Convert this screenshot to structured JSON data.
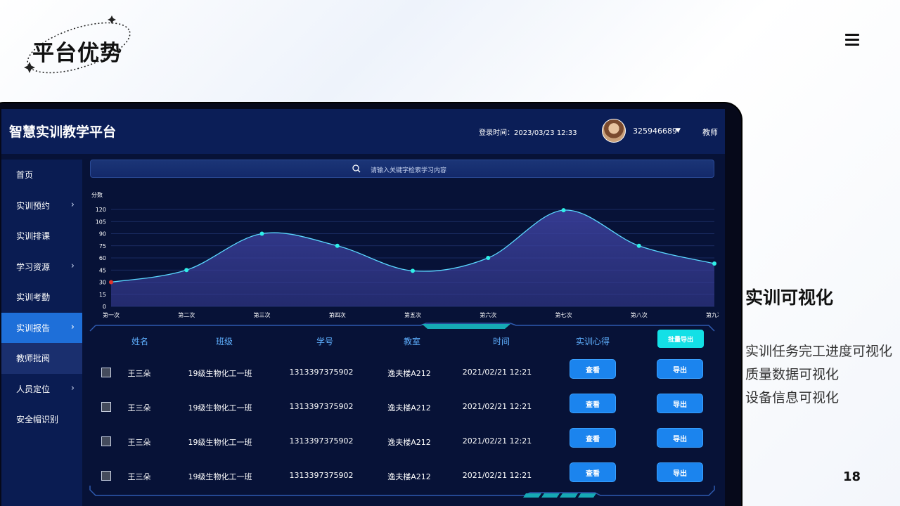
{
  "slide": {
    "title": "平台优势",
    "page_number": "18",
    "feature_title": "实训可视化",
    "features": [
      "实训任务完工进度可视化",
      "质量数据可视化",
      "设备信息可视化"
    ]
  },
  "app": {
    "title": "智慧实训教学平台",
    "login_time": "登录时间：2023/03/23 12:33",
    "user_id": "325946689",
    "role": "教师",
    "search_placeholder": "请输入关键字检索学习内容"
  },
  "sidebar": {
    "items": [
      {
        "label": "首页",
        "chevron": false
      },
      {
        "label": "实训预约",
        "chevron": true
      },
      {
        "label": "实训排课",
        "chevron": false
      },
      {
        "label": "学习资源",
        "chevron": true
      },
      {
        "label": "实训考勤",
        "chevron": false
      },
      {
        "label": "实训报告",
        "chevron": true,
        "active": true
      },
      {
        "label": "教师批阅",
        "chevron": false
      },
      {
        "label": "人员定位",
        "chevron": true
      },
      {
        "label": "安全帽识别",
        "chevron": false
      }
    ]
  },
  "chart_data": {
    "type": "area",
    "ylabel": "分数",
    "ylim": [
      0,
      120
    ],
    "yticks": [
      0,
      15,
      30,
      45,
      60,
      75,
      90,
      105,
      120
    ],
    "categories": [
      "第一次",
      "第二次",
      "第三次",
      "第四次",
      "第五次",
      "第六次",
      "第七次",
      "第八次",
      "第九次"
    ],
    "values": [
      30,
      45,
      90,
      75,
      44,
      60,
      119,
      75,
      53
    ],
    "grid": true,
    "colors": {
      "line": "#5ad8ff",
      "point": "#2ff0e8",
      "first_point": "#e0342c",
      "fill": "#3a3f9a"
    }
  },
  "table": {
    "headers": [
      "姓名",
      "班级",
      "学号",
      "教室",
      "时间",
      "实训心得"
    ],
    "export_all_label": "批量导出",
    "view_label": "查看",
    "export_label": "导出",
    "rows": [
      [
        "王三朵",
        "19级生物化工一班",
        "1313397375902",
        "逸夫楼A212",
        "2021/02/21 12:21"
      ],
      [
        "王三朵",
        "19级生物化工一班",
        "1313397375902",
        "逸夫楼A212",
        "2021/02/21 12:21"
      ],
      [
        "王三朵",
        "19级生物化工一班",
        "1313397375902",
        "逸夫楼A212",
        "2021/02/21 12:21"
      ],
      [
        "王三朵",
        "19级生物化工一班",
        "1313397375902",
        "逸夫楼A212",
        "2021/02/21 12:21"
      ]
    ]
  }
}
